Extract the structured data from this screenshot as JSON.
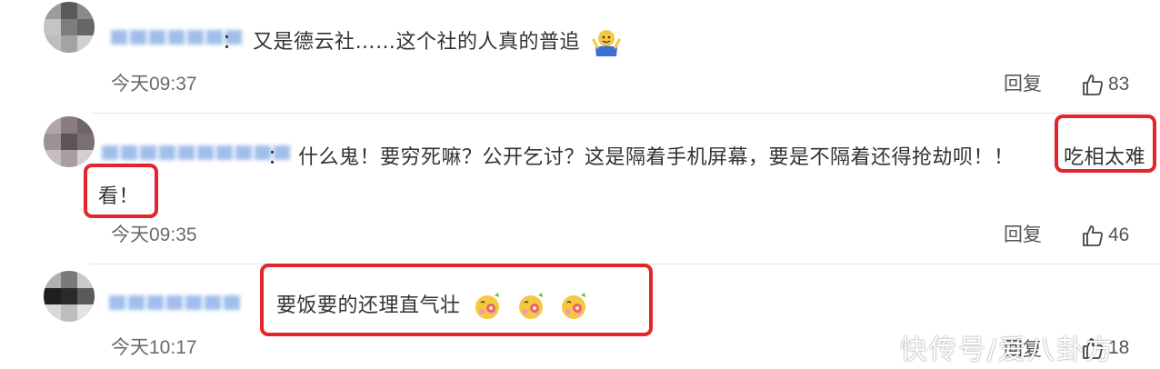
{
  "comments": [
    {
      "separator": "：",
      "text": "又是德云社……这个社的人真的普追",
      "time": "今天09:37",
      "reply_label": "回复",
      "likes": "83",
      "emoji_icon": "shrug-person-icon"
    },
    {
      "separator": "：",
      "text_line1": "什么鬼！要穷死嘛？公开乞讨？这是隔着手机屏幕，要是不隔着还得抢劫呗！！",
      "text_highlight_1": "吃相太难",
      "text_highlight_2": "看！",
      "time": "今天09:35",
      "reply_label": "回复",
      "likes": "46"
    },
    {
      "separator": "：",
      "text": "要饭要的还理直气壮",
      "time": "今天10:17",
      "reply_label": "回复",
      "likes": "18",
      "emoji_icon": "flower-shy-face-icon"
    }
  ],
  "watermark": "快传号/爱八卦方",
  "colors": {
    "highlight_box": "#e2262b",
    "username": "#8fb3e6",
    "divider": "#e6e6e6"
  }
}
